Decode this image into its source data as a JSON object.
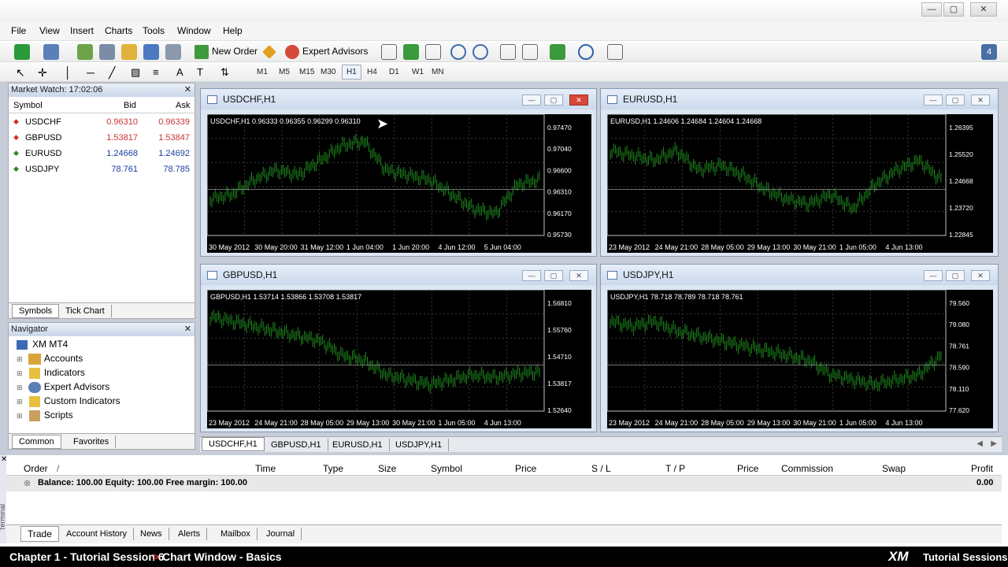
{
  "window": {
    "minimize": "—",
    "maximize": "▢",
    "close": "✕"
  },
  "menu": [
    "File",
    "View",
    "Insert",
    "Charts",
    "Tools",
    "Window",
    "Help"
  ],
  "toolbar": {
    "new_order": "New Order",
    "expert_advisors": "Expert Advisors",
    "badge": "4"
  },
  "timeframes": [
    "M1",
    "M5",
    "M15",
    "M30",
    "H1",
    "H4",
    "D1",
    "W1",
    "MN"
  ],
  "market_watch": {
    "title": "Market Watch: 17:02:06",
    "col_symbol": "Symbol",
    "col_bid": "Bid",
    "col_ask": "Ask",
    "rows": [
      {
        "symbol": "USDCHF",
        "bid": "0.96310",
        "ask": "0.96339"
      },
      {
        "symbol": "GBPUSD",
        "bid": "1.53817",
        "ask": "1.53847"
      },
      {
        "symbol": "EURUSD",
        "bid": "1.24668",
        "ask": "1.24692"
      },
      {
        "symbol": "USDJPY",
        "bid": "78.761",
        "ask": "78.785"
      }
    ],
    "tabs": [
      "Symbols",
      "Tick Chart"
    ]
  },
  "navigator": {
    "title": "Navigator",
    "root": "XM MT4",
    "items": [
      "Accounts",
      "Indicators",
      "Expert Advisors",
      "Custom Indicators",
      "Scripts"
    ],
    "tabs": [
      "Common",
      "Favorites"
    ]
  },
  "charts": [
    {
      "title": "USDCHF,H1",
      "info": "USDCHF,H1  0.96333 0.96355 0.96299 0.96310",
      "prices": [
        "0.97470",
        "0.97040",
        "0.96600",
        "0.96310",
        "0.96170",
        "0.95730"
      ],
      "dates": [
        "30 May 2012",
        "30 May 20:00",
        "31 May 12:00",
        "1 Jun 04:00",
        "1 Jun 20:00",
        "4 Jun 12:00",
        "5 Jun 04:00"
      ]
    },
    {
      "title": "EURUSD,H1",
      "info": "EURUSD,H1  1.24606 1.24684 1.24604 1.24668",
      "prices": [
        "1.26395",
        "1.25520",
        "1.24668",
        "1.23720",
        "1.22845"
      ],
      "dates": [
        "23 May 2012",
        "24 May 21:00",
        "28 May 05:00",
        "29 May 13:00",
        "30 May 21:00",
        "1 Jun 05:00",
        "4 Jun 13:00"
      ]
    },
    {
      "title": "GBPUSD,H1",
      "info": "GBPUSD,H1  1.53714 1.53866 1.53708 1.53817",
      "prices": [
        "1.56810",
        "1.55760",
        "1.54710",
        "1.53817",
        "1.52640"
      ],
      "dates": [
        "23 May 2012",
        "24 May 21:00",
        "28 May 05:00",
        "29 May 13:00",
        "30 May 21:00",
        "1 Jun 05:00",
        "4 Jun 13:00"
      ]
    },
    {
      "title": "USDJPY,H1",
      "info": "USDJPY,H1  78.718 78.789 78.718 78.761",
      "prices": [
        "79.560",
        "79.080",
        "78.761",
        "78.590",
        "78.110",
        "77.620"
      ],
      "dates": [
        "23 May 2012",
        "24 May 21:00",
        "28 May 05:00",
        "29 May 13:00",
        "30 May 21:00",
        "1 Jun 05:00",
        "4 Jun 13:00"
      ]
    }
  ],
  "chart_tabs": [
    "USDCHF,H1",
    "GBPUSD,H1",
    "EURUSD,H1",
    "USDJPY,H1"
  ],
  "terminal": {
    "side_label": "Terminal",
    "columns": [
      "Order",
      "/",
      "Time",
      "Type",
      "Size",
      "Symbol",
      "Price",
      "S / L",
      "T / P",
      "Price",
      "Commission",
      "Swap",
      "Profit"
    ],
    "balance_row": "Balance: 100.00  Equity: 100.00  Free margin: 100.00",
    "profit": "0.00",
    "tabs": [
      "Trade",
      "Account History",
      "News",
      "Alerts",
      "Mailbox",
      "Journal"
    ]
  },
  "footer": {
    "left": "Chapter 1 - Tutorial Session 6",
    "sep": ">",
    "right_part": "Chart Window - Basics",
    "brand": "XM",
    "brand_sub": "Tutorial Sessions"
  },
  "colors": {
    "chart_bg": "#000000",
    "candle": "#1f8a1f",
    "panel_header": "#c9d6e8",
    "footer_bg": "#000000",
    "bid_ask_text": "#1a3fa0"
  }
}
